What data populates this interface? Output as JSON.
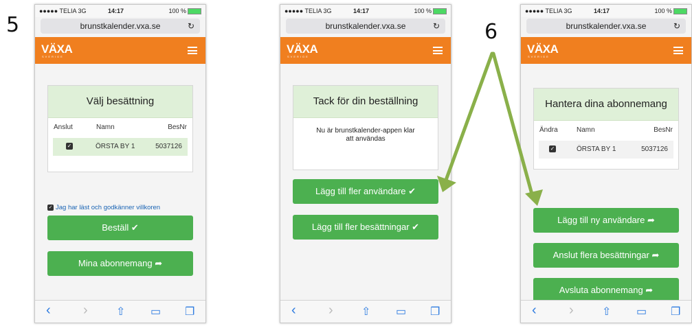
{
  "steps": {
    "five": "5",
    "six": "6"
  },
  "status": {
    "carrier": "●●●●● TELIA 3G",
    "time": "14:17",
    "battery": "100 %"
  },
  "url": "brunstkalender.vxa.se",
  "brand": {
    "logo": "VÄXA",
    "sub": "SVERIGE"
  },
  "screen1": {
    "card_title": "Välj besättning",
    "cols": [
      "Anslut",
      "Namn",
      "BesNr"
    ],
    "row": {
      "name": "ÖRSTA BY 1",
      "nr": "5037126"
    },
    "agree": "Jag har läst och godkänner villkoren",
    "btn_order": "Beställ ✔",
    "btn_subs": "Mina abonnemang ➦"
  },
  "screen2": {
    "card_title": "Tack för din beställning",
    "msg_line1": "Nu är brunstkalender-appen klar",
    "msg_line2": "att användas",
    "btn_users": "Lägg till fler användare ✔",
    "btn_herds": "Lägg till fler besättningar ✔"
  },
  "screen3": {
    "card_title": "Hantera dina abonnemang",
    "cols": [
      "Ändra",
      "Namn",
      "BesNr"
    ],
    "row": {
      "name": "ÖRSTA BY 1",
      "nr": "5037126"
    },
    "btn_new_user": "Lägg till ny användare ➦",
    "btn_connect": "Anslut flera besättningar ➦",
    "btn_cancel": "Avsluta abonnemang ➦"
  },
  "toolbar": {
    "back": "‹",
    "forward": "›",
    "share": "⇧",
    "books": "📖",
    "tabs": "❐"
  },
  "colors": {
    "orange": "#f07f1f",
    "green": "#4cb050",
    "light_green": "#dff0d8",
    "arrow": "#8ab04a"
  }
}
